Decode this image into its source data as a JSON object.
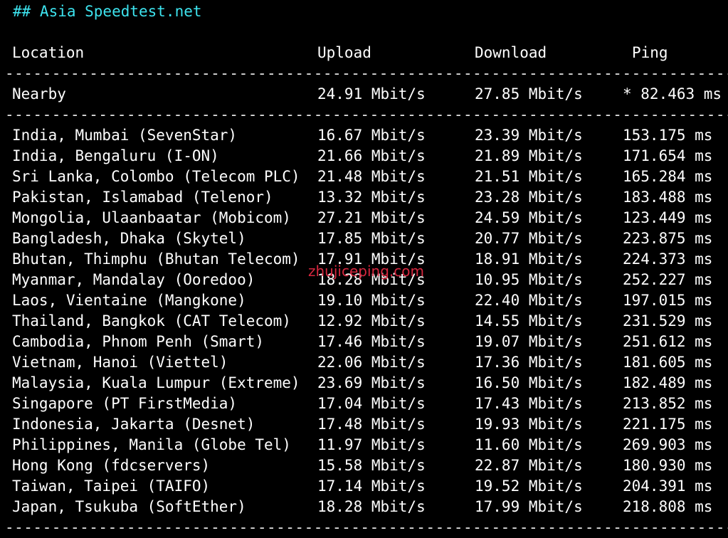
{
  "heading": "## Asia Speedtest.net",
  "columns": {
    "location": "Location",
    "upload": "Upload",
    "download": "Download",
    "ping": "Ping"
  },
  "separator": "-------------------------------------------------------------------------------",
  "nearby": {
    "location": "Nearby",
    "upload": "24.91 Mbit/s",
    "download": "27.85 Mbit/s",
    "ping": "* 82.463 ms"
  },
  "rows": [
    {
      "location": "India, Mumbai (SevenStar)",
      "upload": "16.67 Mbit/s",
      "download": "23.39 Mbit/s",
      "ping": "153.175 ms"
    },
    {
      "location": "India, Bengaluru (I-ON)",
      "upload": "21.66 Mbit/s",
      "download": "21.89 Mbit/s",
      "ping": "171.654 ms"
    },
    {
      "location": "Sri Lanka, Colombo (Telecom PLC)",
      "upload": "21.48 Mbit/s",
      "download": "21.51 Mbit/s",
      "ping": "165.284 ms"
    },
    {
      "location": "Pakistan, Islamabad (Telenor)",
      "upload": "13.32 Mbit/s",
      "download": "23.28 Mbit/s",
      "ping": "183.488 ms"
    },
    {
      "location": "Mongolia, Ulaanbaatar (Mobicom)",
      "upload": "27.21 Mbit/s",
      "download": "24.59 Mbit/s",
      "ping": "123.449 ms"
    },
    {
      "location": "Bangladesh, Dhaka (Skytel)",
      "upload": "17.85 Mbit/s",
      "download": "20.77 Mbit/s",
      "ping": "223.875 ms"
    },
    {
      "location": "Bhutan, Thimphu (Bhutan Telecom)",
      "upload": "17.91 Mbit/s",
      "download": "18.91 Mbit/s",
      "ping": "224.373 ms"
    },
    {
      "location": "Myanmar, Mandalay (Ooredoo)",
      "upload": "18.28 Mbit/s",
      "download": "10.95 Mbit/s",
      "ping": "252.227 ms"
    },
    {
      "location": "Laos, Vientaine (Mangkone)",
      "upload": "19.10 Mbit/s",
      "download": "22.40 Mbit/s",
      "ping": "197.015 ms"
    },
    {
      "location": "Thailand, Bangkok (CAT Telecom)",
      "upload": "12.92 Mbit/s",
      "download": "14.55 Mbit/s",
      "ping": "231.529 ms"
    },
    {
      "location": "Cambodia, Phnom Penh (Smart)",
      "upload": "17.46 Mbit/s",
      "download": "19.07 Mbit/s",
      "ping": "251.612 ms"
    },
    {
      "location": "Vietnam, Hanoi (Viettel)",
      "upload": "22.06 Mbit/s",
      "download": "17.36 Mbit/s",
      "ping": "181.605 ms"
    },
    {
      "location": "Malaysia, Kuala Lumpur (Extreme)",
      "upload": "23.69 Mbit/s",
      "download": "16.50 Mbit/s",
      "ping": "182.489 ms"
    },
    {
      "location": "Singapore (PT FirstMedia)",
      "upload": "17.04 Mbit/s",
      "download": "17.43 Mbit/s",
      "ping": "213.852 ms"
    },
    {
      "location": "Indonesia, Jakarta (Desnet)",
      "upload": "17.48 Mbit/s",
      "download": "19.93 Mbit/s",
      "ping": "221.175 ms"
    },
    {
      "location": "Philippines, Manila (Globe Tel)",
      "upload": "11.97 Mbit/s",
      "download": "11.60 Mbit/s",
      "ping": "269.903 ms"
    },
    {
      "location": "Hong Kong (fdcservers)",
      "upload": "15.58 Mbit/s",
      "download": "22.87 Mbit/s",
      "ping": "180.930 ms"
    },
    {
      "location": "Taiwan, Taipei (TAIFO)",
      "upload": "17.14 Mbit/s",
      "download": "19.52 Mbit/s",
      "ping": "204.391 ms"
    },
    {
      "location": "Japan, Tsukuba (SoftEther)",
      "upload": "18.28 Mbit/s",
      "download": "17.99 Mbit/s",
      "ping": "218.808 ms"
    }
  ],
  "watermark": "zhujiceping.com",
  "colors": {
    "background": "#000000",
    "text": "#ffffff",
    "heading": "#3de3ee",
    "watermark": "#d6263e"
  }
}
